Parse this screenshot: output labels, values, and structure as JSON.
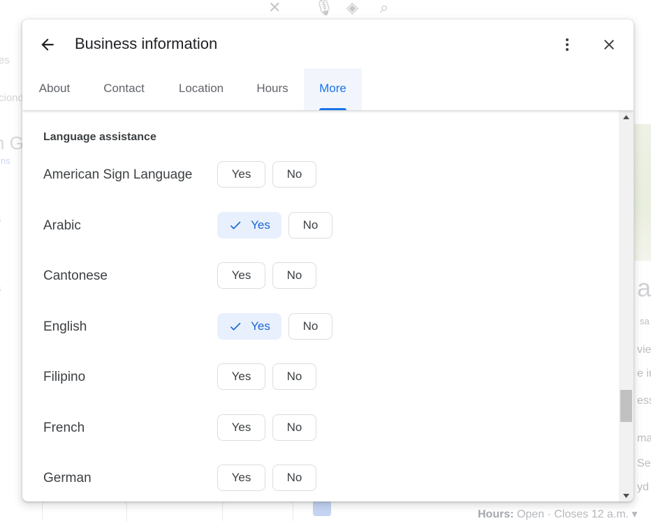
{
  "dialog": {
    "title": "Business information",
    "tabs": [
      {
        "label": "About"
      },
      {
        "label": "Contact"
      },
      {
        "label": "Location"
      },
      {
        "label": "Hours"
      },
      {
        "label": "More",
        "active": true
      }
    ]
  },
  "section": {
    "title": "Language assistance",
    "rows": [
      {
        "label": "American Sign Language",
        "yes": "Yes",
        "no": "No",
        "selected": "none"
      },
      {
        "label": "Arabic",
        "yes": "Yes",
        "no": "No",
        "selected": "yes"
      },
      {
        "label": "Cantonese",
        "yes": "Yes",
        "no": "No",
        "selected": "none"
      },
      {
        "label": "English",
        "yes": "Yes",
        "no": "No",
        "selected": "yes"
      },
      {
        "label": "Filipino",
        "yes": "Yes",
        "no": "No",
        "selected": "none"
      },
      {
        "label": "French",
        "yes": "Yes",
        "no": "No",
        "selected": "none"
      },
      {
        "label": "German",
        "yes": "Yes",
        "no": "No",
        "selected": "none"
      }
    ]
  },
  "background": {
    "left_fragments": [
      "es",
      "ciond",
      "n G",
      "ins",
      "s",
      "s"
    ],
    "right_fragments": [
      "a",
      "sa",
      "view",
      "e in",
      "ess",
      "ma",
      "Se",
      "yd #"
    ],
    "hours_label": "Hours:",
    "hours_value": "Open · Closes 12 a.m. ▾"
  },
  "colors": {
    "accent": "#1a73e8",
    "selected_chip_bg": "#e8f0fe",
    "text": "#3c4043"
  },
  "icons": {
    "back": "arrow-left-icon",
    "menu": "more-vert-icon",
    "close": "close-icon",
    "check": "check-icon"
  }
}
